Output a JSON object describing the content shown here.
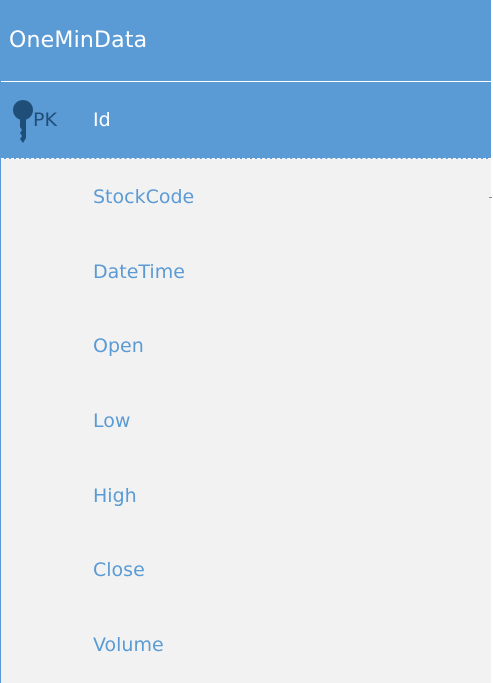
{
  "entity": {
    "name": "OneMinData",
    "primary_key": {
      "marker": "PK",
      "field": "Id"
    },
    "fields": [
      "StockCode",
      "DateTime",
      "Open",
      "Low",
      "High",
      "Close",
      "Volume"
    ]
  },
  "colors": {
    "header": "#5b9bd5",
    "body": "#f2f2f2",
    "pk_text": "#1f4e79",
    "field_text": "#5b9bd5"
  },
  "icons": {
    "pk_icon": "key-icon"
  }
}
